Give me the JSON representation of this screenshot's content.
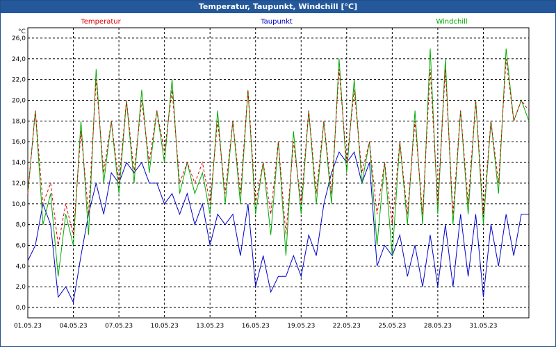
{
  "window": {
    "title": "Temperatur, Taupunkt, Windchill [°C]"
  },
  "chart_data": {
    "type": "line",
    "title": "Temperatur, Taupunkt, Windchill [°C]",
    "ylabel": "°C",
    "ylim": [
      -1,
      27
    ],
    "grid": true,
    "legend": "top",
    "x_ticks": [
      "01.05.23",
      "04.05.23",
      "07.05.23",
      "10.05.23",
      "13.05.23",
      "16.05.23",
      "19.05.23",
      "22.05.23",
      "25.05.23",
      "28.05.23",
      "31.05.23"
    ],
    "y_ticks": [
      0,
      2,
      4,
      6,
      8,
      10,
      12,
      14,
      16,
      18,
      20,
      22,
      24,
      26
    ],
    "y_tick_labels": [
      "0,0",
      "2,0",
      "4,0",
      "6,0",
      "8,0",
      "10,0",
      "12,0",
      "14,0",
      "16,0",
      "18,0",
      "20,0",
      "22,0",
      "24,0",
      "26,0"
    ],
    "x_days": [
      0,
      0.5,
      1,
      1.5,
      2,
      2.5,
      3,
      3.5,
      4,
      4.5,
      5,
      5.5,
      6,
      6.5,
      7,
      7.5,
      8,
      8.5,
      9,
      9.5,
      10,
      10.5,
      11,
      11.5,
      12,
      12.5,
      13,
      13.5,
      14,
      14.5,
      15,
      15.5,
      16,
      16.5,
      17,
      17.5,
      18,
      18.5,
      19,
      19.5,
      20,
      20.5,
      21,
      21.5,
      22,
      22.5,
      23,
      23.5,
      24,
      24.5,
      25,
      25.5,
      26,
      26.5,
      27,
      27.5,
      28,
      28.5,
      29,
      29.5,
      30,
      30.5,
      31,
      31.5,
      32,
      32.5,
      33
    ],
    "series": [
      {
        "name": "Temperatur",
        "color": "#dd0000",
        "values": [
          11,
          19,
          10,
          12,
          6,
          10,
          7,
          17,
          9,
          22,
          13,
          18,
          12,
          20,
          13,
          20,
          14,
          19,
          15,
          21,
          12,
          14,
          12,
          14,
          10,
          18,
          11,
          18,
          11,
          21,
          10,
          14,
          9,
          16,
          7,
          16,
          10,
          19,
          11,
          18,
          11,
          23,
          14,
          21,
          13,
          16,
          9,
          14,
          8,
          16,
          9,
          18,
          9,
          23,
          10,
          23,
          9,
          19,
          10,
          20,
          9,
          18,
          12,
          24,
          18,
          20,
          19
        ]
      },
      {
        "name": "Taupunkt",
        "color": "#0000cc",
        "values": [
          4.5,
          6,
          10,
          8,
          1,
          2,
          0.5,
          5,
          9,
          12,
          9,
          13,
          12,
          14,
          13,
          14,
          12,
          12,
          10,
          11,
          9,
          11,
          8,
          10,
          6,
          9,
          8,
          9,
          5,
          10,
          2,
          5,
          1.5,
          3,
          3,
          5,
          3,
          7,
          5,
          10,
          13,
          15,
          14,
          15,
          12,
          14,
          4,
          6,
          5,
          7,
          3,
          6,
          2,
          7,
          2,
          8,
          2,
          9,
          3,
          9,
          1,
          8,
          4,
          9,
          5,
          9,
          9
        ]
      },
      {
        "name": "Windchill",
        "color": "#00aa00",
        "values": [
          11,
          19,
          8,
          11,
          3,
          9,
          6,
          18,
          7,
          23,
          12,
          18,
          11,
          20,
          12,
          21,
          13,
          19,
          14,
          22,
          11,
          14,
          11,
          13,
          9,
          19,
          10,
          18,
          10,
          21,
          9,
          14,
          7,
          16,
          5,
          17,
          9,
          19,
          10,
          18,
          10,
          24,
          13,
          22,
          12,
          16,
          6,
          14,
          5,
          16,
          8,
          19,
          8,
          25,
          9,
          24,
          8,
          19,
          9,
          20,
          8,
          18,
          11,
          25,
          18,
          20,
          18
        ]
      }
    ]
  }
}
